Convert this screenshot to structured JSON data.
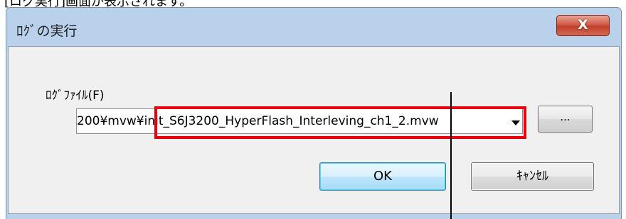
{
  "caption": "[ログ実行]画面が表示されます。",
  "dialog": {
    "title": "ﾛｸﾞの実行",
    "close_label": "X",
    "file_label": "ﾛｸﾞﾌｧｲﾙ(F)",
    "file_value": "200¥mvw¥init_S6J3200_HyperFlash_Interleving_ch1_2.mvw",
    "browse_label": "...",
    "ok_label": "OK",
    "cancel_label": "ｷｬﾝｾﾙ"
  },
  "colors": {
    "highlight": "#e8000d",
    "title_bar": "#b9d1ea",
    "close_button": "#c0402c"
  }
}
